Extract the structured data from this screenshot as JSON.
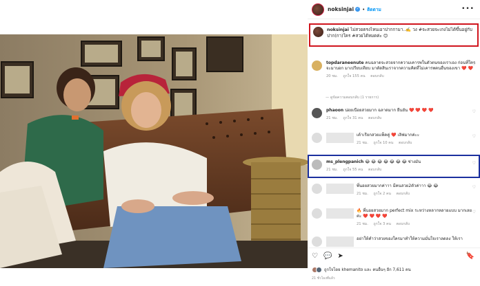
{
  "header": {
    "username": "noksinjai",
    "verified_mark": "✓",
    "separator": "•",
    "follow_label": "ติดตาม",
    "more_icon": "•••"
  },
  "caption": {
    "username": "noksinjai",
    "text": "ไม่สวยตรงไหนเอาปากกามา..✍️ วง #จะสวยจะเกงไม่ได้ขึ้นอยู่กับปาก(กา)ใคร #สวยได้หมดค่ะ 😊"
  },
  "comments": [
    {
      "username": "topdaraneenute",
      "text": "คนฉลาดจะสวยจากความเคารพในตัวตนของเราเอง ก่อนที่ใครจะมาบอก มาเปรียบเทียบ มาตัดสินเราจากความคิดที่ไม่เคารพคนอื่นของเขา ❤️ ❤️",
      "time": "20 ชม.",
      "likes": "ถูกใจ 155 คน",
      "reply": "ตอบกลับ",
      "view_replies": "— ดูข้อความตอบกลับ (1 รายการ)"
    },
    {
      "username": "phaoon",
      "text": "น่อยเนือยสวยมาก ฉลาดมาก ยืนยัน ❤️ ❤️ ❤️ ❤️",
      "time": "21 ชม.",
      "likes": "ถูกใจ 31 คน",
      "reply": "ตอบกลับ"
    },
    {
      "username": "",
      "text": "เค้าเรียกสวยแพ็คคู่ ❤️ เลิฟมากค่ะะ",
      "time": "21 ชม.",
      "likes": "ถูกใจ 10 คน",
      "reply": "ตอบกลับ"
    },
    {
      "username": "ms_plengpanich",
      "text": "😂 😂 😂 😂 😂 😂 😂 ช่างมัน",
      "time": "21 ชม.",
      "likes": "ถูกใจ 55 คน",
      "reply": "ตอบกลับ"
    },
    {
      "username": "",
      "text": "พี่นอยสวยมากค่าาา มีคนสวย2ตัวค่าาา 😂 😂",
      "time": "21 ชม.",
      "likes": "ถูกใจ 2 คน",
      "reply": "ตอบกลับ"
    },
    {
      "username": "",
      "text": "🔥 พี่นอยสวยมาก perfect mix ระหว่างหลากหลายแบบ มากเลยค่ะ ❤️ ❤️ ❤️ ❤️",
      "time": "21 ชม.",
      "likes": "ถูกใจ 3 คน",
      "reply": "ตอบกลับ"
    },
    {
      "username": "",
      "text": "อย่าให้คำว่าสวยของใครมาทำให้ความมั่นใจเราลดลง ให้เรา",
      "time": "",
      "likes": "",
      "reply": ""
    }
  ],
  "footer": {
    "like_icon": "♡",
    "comment_icon": "💬",
    "share_icon": "➤",
    "bookmark_icon": "🔖",
    "likes_text": "ถูกใจโดย khemanito และ คนอื่นๆ อีก 7,611 คน",
    "date": "21 ชั่วโมงที่แล้ว"
  }
}
